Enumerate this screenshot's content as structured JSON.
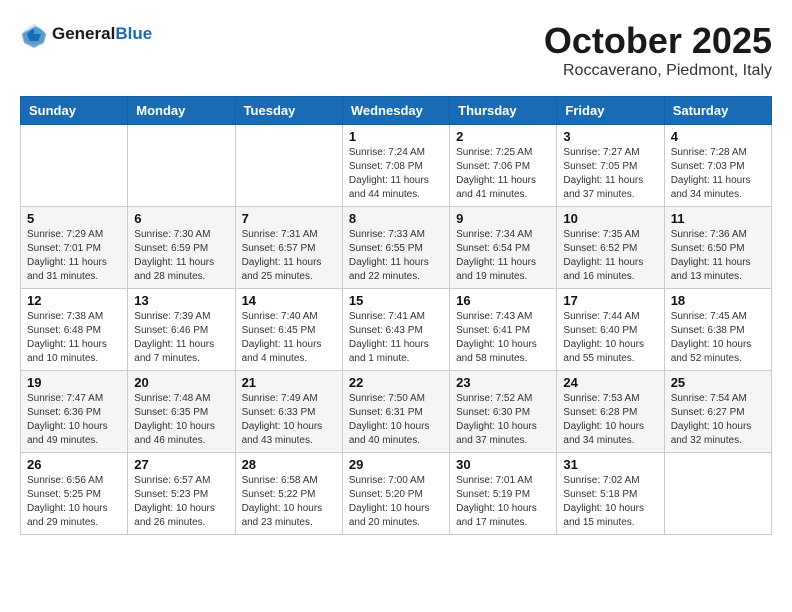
{
  "header": {
    "logo_line1": "General",
    "logo_line2": "Blue",
    "month": "October 2025",
    "location": "Roccaverano, Piedmont, Italy"
  },
  "days_of_week": [
    "Sunday",
    "Monday",
    "Tuesday",
    "Wednesday",
    "Thursday",
    "Friday",
    "Saturday"
  ],
  "weeks": [
    [
      {
        "day": "",
        "info": ""
      },
      {
        "day": "",
        "info": ""
      },
      {
        "day": "",
        "info": ""
      },
      {
        "day": "1",
        "info": "Sunrise: 7:24 AM\nSunset: 7:08 PM\nDaylight: 11 hours\nand 44 minutes."
      },
      {
        "day": "2",
        "info": "Sunrise: 7:25 AM\nSunset: 7:06 PM\nDaylight: 11 hours\nand 41 minutes."
      },
      {
        "day": "3",
        "info": "Sunrise: 7:27 AM\nSunset: 7:05 PM\nDaylight: 11 hours\nand 37 minutes."
      },
      {
        "day": "4",
        "info": "Sunrise: 7:28 AM\nSunset: 7:03 PM\nDaylight: 11 hours\nand 34 minutes."
      }
    ],
    [
      {
        "day": "5",
        "info": "Sunrise: 7:29 AM\nSunset: 7:01 PM\nDaylight: 11 hours\nand 31 minutes."
      },
      {
        "day": "6",
        "info": "Sunrise: 7:30 AM\nSunset: 6:59 PM\nDaylight: 11 hours\nand 28 minutes."
      },
      {
        "day": "7",
        "info": "Sunrise: 7:31 AM\nSunset: 6:57 PM\nDaylight: 11 hours\nand 25 minutes."
      },
      {
        "day": "8",
        "info": "Sunrise: 7:33 AM\nSunset: 6:55 PM\nDaylight: 11 hours\nand 22 minutes."
      },
      {
        "day": "9",
        "info": "Sunrise: 7:34 AM\nSunset: 6:54 PM\nDaylight: 11 hours\nand 19 minutes."
      },
      {
        "day": "10",
        "info": "Sunrise: 7:35 AM\nSunset: 6:52 PM\nDaylight: 11 hours\nand 16 minutes."
      },
      {
        "day": "11",
        "info": "Sunrise: 7:36 AM\nSunset: 6:50 PM\nDaylight: 11 hours\nand 13 minutes."
      }
    ],
    [
      {
        "day": "12",
        "info": "Sunrise: 7:38 AM\nSunset: 6:48 PM\nDaylight: 11 hours\nand 10 minutes."
      },
      {
        "day": "13",
        "info": "Sunrise: 7:39 AM\nSunset: 6:46 PM\nDaylight: 11 hours\nand 7 minutes."
      },
      {
        "day": "14",
        "info": "Sunrise: 7:40 AM\nSunset: 6:45 PM\nDaylight: 11 hours\nand 4 minutes."
      },
      {
        "day": "15",
        "info": "Sunrise: 7:41 AM\nSunset: 6:43 PM\nDaylight: 11 hours\nand 1 minute."
      },
      {
        "day": "16",
        "info": "Sunrise: 7:43 AM\nSunset: 6:41 PM\nDaylight: 10 hours\nand 58 minutes."
      },
      {
        "day": "17",
        "info": "Sunrise: 7:44 AM\nSunset: 6:40 PM\nDaylight: 10 hours\nand 55 minutes."
      },
      {
        "day": "18",
        "info": "Sunrise: 7:45 AM\nSunset: 6:38 PM\nDaylight: 10 hours\nand 52 minutes."
      }
    ],
    [
      {
        "day": "19",
        "info": "Sunrise: 7:47 AM\nSunset: 6:36 PM\nDaylight: 10 hours\nand 49 minutes."
      },
      {
        "day": "20",
        "info": "Sunrise: 7:48 AM\nSunset: 6:35 PM\nDaylight: 10 hours\nand 46 minutes."
      },
      {
        "day": "21",
        "info": "Sunrise: 7:49 AM\nSunset: 6:33 PM\nDaylight: 10 hours\nand 43 minutes."
      },
      {
        "day": "22",
        "info": "Sunrise: 7:50 AM\nSunset: 6:31 PM\nDaylight: 10 hours\nand 40 minutes."
      },
      {
        "day": "23",
        "info": "Sunrise: 7:52 AM\nSunset: 6:30 PM\nDaylight: 10 hours\nand 37 minutes."
      },
      {
        "day": "24",
        "info": "Sunrise: 7:53 AM\nSunset: 6:28 PM\nDaylight: 10 hours\nand 34 minutes."
      },
      {
        "day": "25",
        "info": "Sunrise: 7:54 AM\nSunset: 6:27 PM\nDaylight: 10 hours\nand 32 minutes."
      }
    ],
    [
      {
        "day": "26",
        "info": "Sunrise: 6:56 AM\nSunset: 5:25 PM\nDaylight: 10 hours\nand 29 minutes."
      },
      {
        "day": "27",
        "info": "Sunrise: 6:57 AM\nSunset: 5:23 PM\nDaylight: 10 hours\nand 26 minutes."
      },
      {
        "day": "28",
        "info": "Sunrise: 6:58 AM\nSunset: 5:22 PM\nDaylight: 10 hours\nand 23 minutes."
      },
      {
        "day": "29",
        "info": "Sunrise: 7:00 AM\nSunset: 5:20 PM\nDaylight: 10 hours\nand 20 minutes."
      },
      {
        "day": "30",
        "info": "Sunrise: 7:01 AM\nSunset: 5:19 PM\nDaylight: 10 hours\nand 17 minutes."
      },
      {
        "day": "31",
        "info": "Sunrise: 7:02 AM\nSunset: 5:18 PM\nDaylight: 10 hours\nand 15 minutes."
      },
      {
        "day": "",
        "info": ""
      }
    ]
  ]
}
